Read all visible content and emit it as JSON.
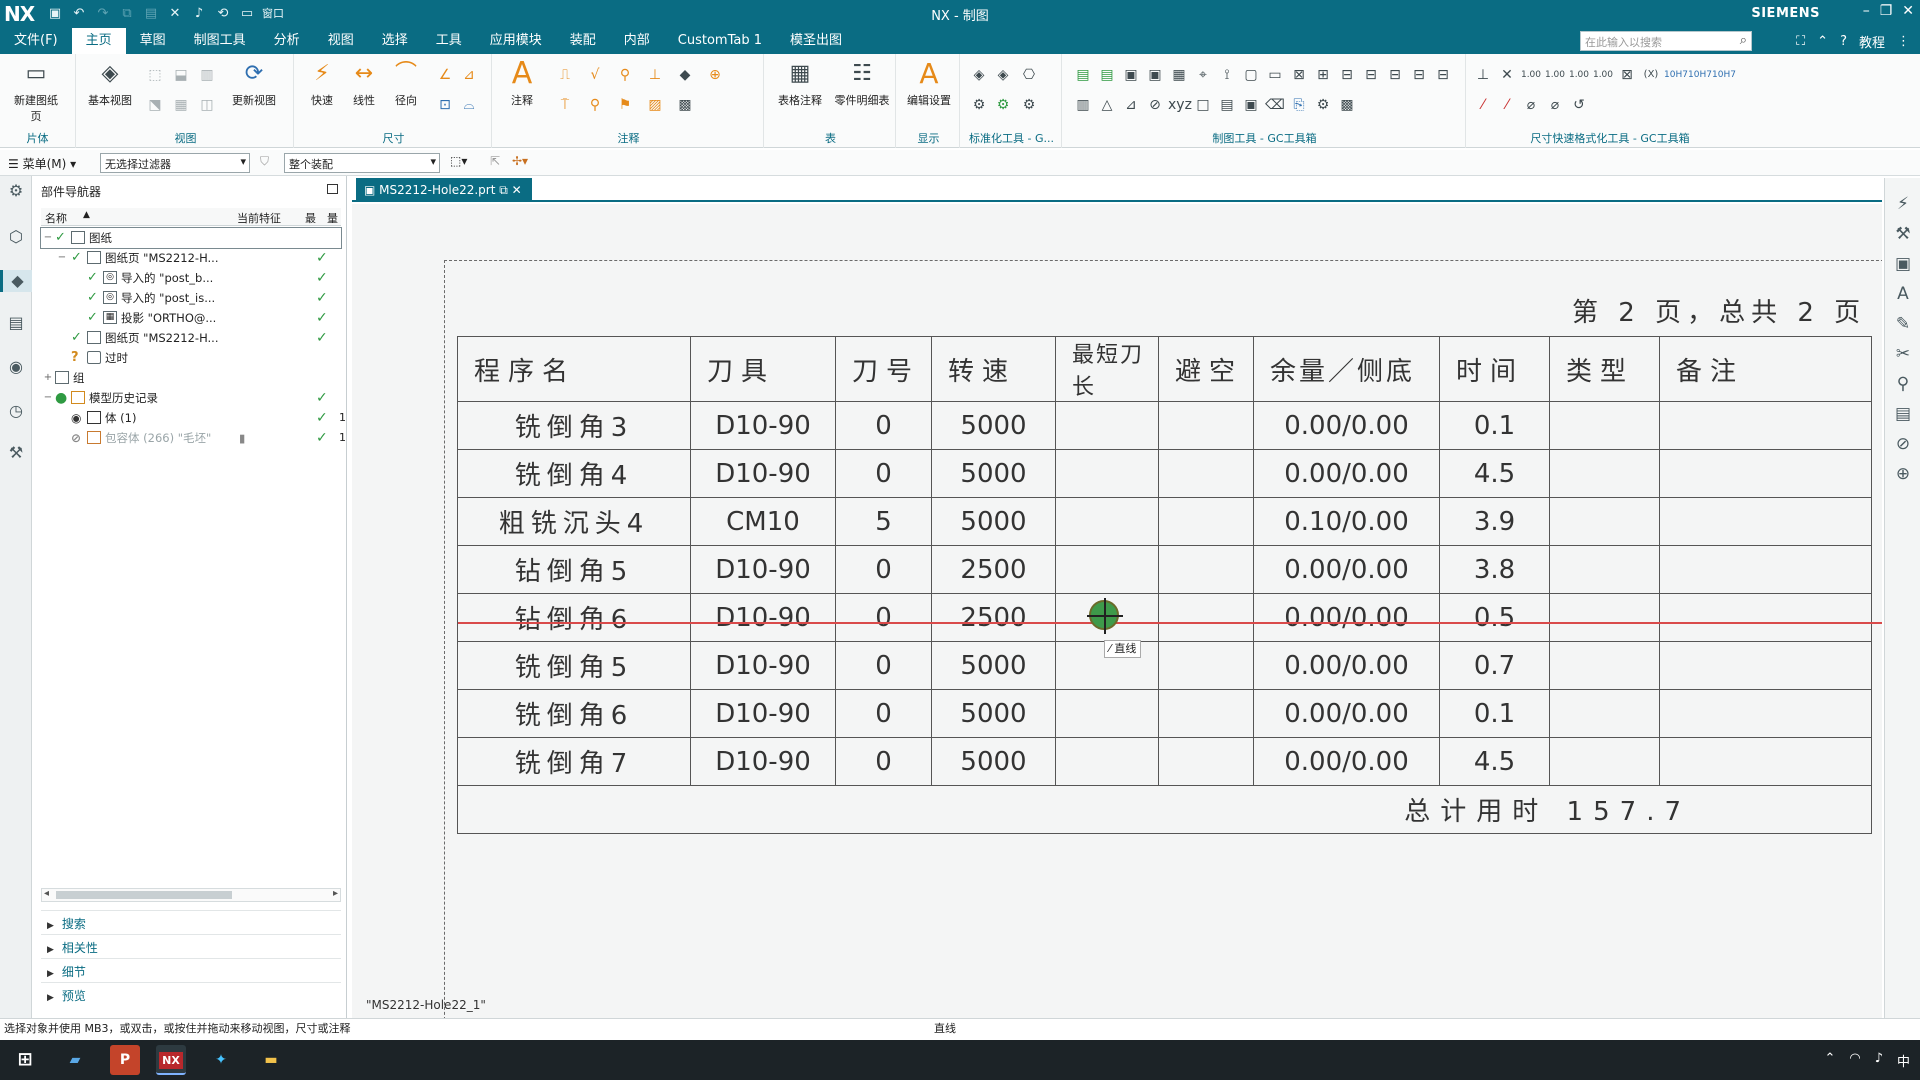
{
  "titlebar": {
    "logo": "NX",
    "window_title": "NX - 制图",
    "brand": "SIEMENS",
    "quick_access": [
      "save-icon",
      "undo-icon",
      "redo-icon",
      "copy-icon",
      "paste-icon",
      "close-x-icon",
      "mic-icon",
      "link-icon",
      "window-icon"
    ],
    "window_menu_label": "窗口",
    "controls": [
      "minimize",
      "restore",
      "close"
    ]
  },
  "menubar": {
    "items": [
      "文件(F)",
      "主页",
      "草图",
      "制图工具",
      "分析",
      "视图",
      "选择",
      "工具",
      "应用模块",
      "装配",
      "内部",
      "CustomTab 1",
      "模圣出图"
    ],
    "active": "主页",
    "search_placeholder": "在此输入以搜索",
    "tutorial": "教程"
  },
  "ribbon": {
    "groups": [
      {
        "label": "片体",
        "buttons": [
          "新建图纸页"
        ]
      },
      {
        "label": "视图",
        "buttons": [
          "基本视图",
          "更新视图"
        ]
      },
      {
        "label": "尺寸",
        "buttons": [
          "快速",
          "线性",
          "径向"
        ]
      },
      {
        "label": "注释",
        "buttons": [
          "注释"
        ]
      },
      {
        "label": "表",
        "buttons": [
          "表格注释",
          "零件明细表"
        ]
      },
      {
        "label": "显示",
        "buttons": [
          "编辑设置"
        ]
      },
      {
        "label": "标准化工具 - G...",
        "buttons": []
      },
      {
        "label": "制图工具 - GC工具箱",
        "buttons": []
      },
      {
        "label": "尺寸快速格式化工具 - GC工具箱",
        "buttons": []
      }
    ]
  },
  "toolbar2": {
    "menu_label": "菜单(M)",
    "filter": "无选择过滤器",
    "scope": "整个装配"
  },
  "navigator": {
    "title": "部件导航器",
    "columns": [
      "名称",
      "当前特征",
      "最",
      "量"
    ],
    "rows": [
      {
        "label": "图纸",
        "status": ""
      },
      {
        "label": "图纸页 \"MS2212-H...",
        "status": "✓"
      },
      {
        "label": "导入的 \"post_b...",
        "status": "✓"
      },
      {
        "label": "导入的 \"post_is...",
        "status": "✓"
      },
      {
        "label": "投影 \"ORTHO@...",
        "status": "✓"
      },
      {
        "label": "图纸页 \"MS2212-H...",
        "status": "✓"
      },
      {
        "label": "过时",
        "status": ""
      },
      {
        "label": "组",
        "status": ""
      },
      {
        "label": "模型历史记录",
        "status": "✓"
      },
      {
        "label": "体 (1)",
        "status": "✓",
        "num": "1"
      },
      {
        "label": "包容体 (266) \"毛坯\"",
        "status": "✓",
        "num": "1"
      }
    ],
    "sections": [
      "搜索",
      "相关性",
      "细节",
      "预览"
    ]
  },
  "document": {
    "tab_title": "MS2212-Hole22.prt",
    "view_name": "\"MS2212-Hole22_1\""
  },
  "sheet": {
    "page_info": "第 2 页，总共 2 页",
    "headers": [
      "程序名",
      "刀具",
      "刀号",
      "转速",
      "最短刀长",
      "避空",
      "余量／侧底",
      "时间",
      "类型",
      "备注"
    ],
    "rows": [
      [
        "铣倒角3",
        "D10-90",
        "0",
        "5000",
        "",
        "",
        "0.00/0.00",
        "0.1",
        "",
        ""
      ],
      [
        "铣倒角4",
        "D10-90",
        "0",
        "5000",
        "",
        "",
        "0.00/0.00",
        "4.5",
        "",
        ""
      ],
      [
        "粗铣沉头4",
        "CM10",
        "5",
        "5000",
        "",
        "",
        "0.10/0.00",
        "3.9",
        "",
        ""
      ],
      [
        "钻倒角5",
        "D10-90",
        "0",
        "2500",
        "",
        "",
        "0.00/0.00",
        "3.8",
        "",
        ""
      ],
      [
        "钻倒角6",
        "D10-90",
        "0",
        "2500",
        "",
        "",
        "0.00/0.00",
        "0.5",
        "",
        ""
      ],
      [
        "铣倒角5",
        "D10-90",
        "0",
        "5000",
        "",
        "",
        "0.00/0.00",
        "0.7",
        "",
        ""
      ],
      [
        "铣倒角6",
        "D10-90",
        "0",
        "5000",
        "",
        "",
        "0.00/0.00",
        "0.1",
        "",
        ""
      ],
      [
        "铣倒角7",
        "D10-90",
        "0",
        "5000",
        "",
        "",
        "0.00/0.00",
        "4.5",
        "",
        ""
      ]
    ],
    "total": "总计用时 157.7",
    "cursor_tooltip": "直线"
  },
  "statusbar": {
    "left": "选择对象并使用 MB3，或双击，或按住并拖动来移动视图，尺寸或注释",
    "mid": "直线"
  },
  "taskbar": {
    "apps": [
      "windows-start",
      "file-explorer-blue",
      "powerpoint",
      "nx",
      "app-colorful",
      "file-explorer"
    ],
    "ime": "中"
  },
  "colors": {
    "accent": "#0a6c83",
    "highlight_line": "#d94a4a",
    "check": "#2f9a42"
  }
}
